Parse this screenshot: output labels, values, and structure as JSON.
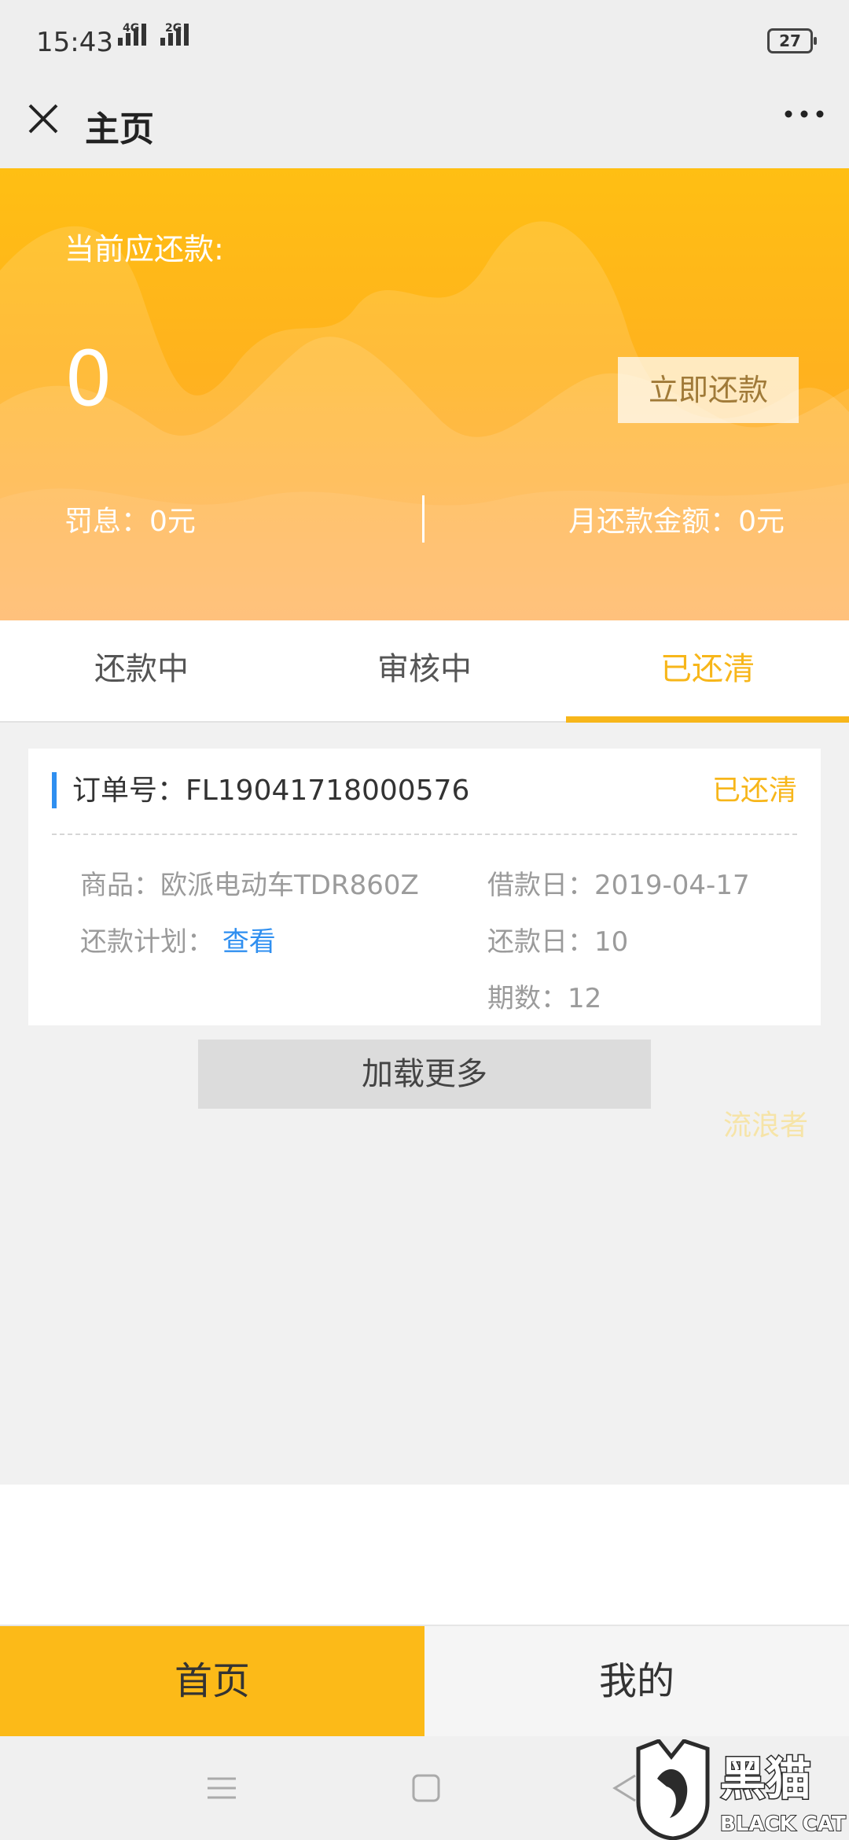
{
  "status_bar": {
    "time": "15:43",
    "network_1": "4G",
    "network_2": "2G",
    "battery": "27"
  },
  "app_bar": {
    "title": "主页",
    "close_icon": "close-icon",
    "more_icon": "more-icon"
  },
  "hero": {
    "label": "当前应还款:",
    "amount": "0",
    "repay_button": "立即还款",
    "penalty": "罚息：0元",
    "monthly": "月还款金额：0元"
  },
  "tabs": [
    {
      "label": "还款中",
      "active": false
    },
    {
      "label": "审核中",
      "active": false
    },
    {
      "label": "已还清",
      "active": true
    }
  ],
  "order": {
    "number": "订单号：FL19041718000576",
    "status": "已还清",
    "product": "商品：欧派电动车TDR860Z",
    "plan_label": "还款计划：",
    "plan_link": "查看",
    "loan_date": "借款日：2019-04-17",
    "repay_day": "还款日：10",
    "periods": "期数：12"
  },
  "load_more": "加载更多",
  "watermark": "流浪者",
  "bottom_nav": [
    {
      "label": "首页",
      "active": true
    },
    {
      "label": "我的",
      "active": false
    }
  ],
  "logo": {
    "name_cn": "黑猫",
    "name_en": "BLACK CAT"
  },
  "colors": {
    "accent": "#f7b61a",
    "hero_top": "#ffbf13",
    "hero_bottom": "#ffa94a",
    "link": "#2f8ff0",
    "nav_active": "#fcba18"
  }
}
